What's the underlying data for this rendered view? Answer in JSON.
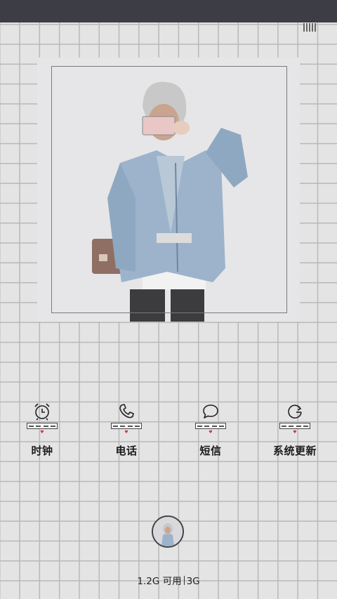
{
  "status_bar": {
    "color": "#3d3d45"
  },
  "photo_widget": {
    "frame_color": "#7a7a7a"
  },
  "apps": [
    {
      "label": "时钟",
      "icon": "alarm-clock-icon"
    },
    {
      "label": "电话",
      "icon": "phone-icon"
    },
    {
      "label": "短信",
      "icon": "chat-bubble-icon"
    },
    {
      "label": "系统更新",
      "icon": "refresh-icon"
    }
  ],
  "dock": {
    "avatar": "avatar-photo"
  },
  "memory": {
    "available": "1.2G 可用",
    "network": "3G"
  }
}
